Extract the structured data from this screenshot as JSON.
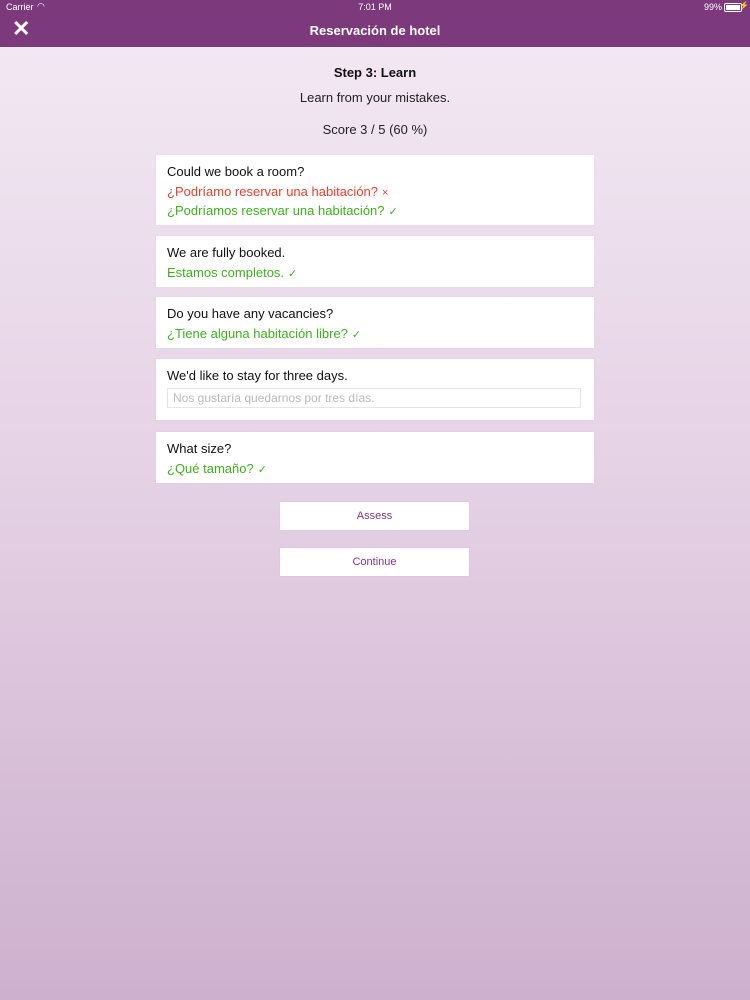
{
  "status_bar": {
    "carrier": "Carrier",
    "time": "7:01 PM",
    "battery": "99%"
  },
  "nav": {
    "title": "Reservación de hotel",
    "close_icon": "close-icon"
  },
  "step": {
    "title": "Step 3: Learn",
    "subtitle": "Learn from your mistakes.",
    "score": "Score 3 / 5 (60 %)"
  },
  "exercises": [
    {
      "question": "Could we book a room?",
      "wrong_answer": "¿Podríamo reservar una habitación?",
      "correct_answer": "¿Podríamos reservar una habitación?"
    },
    {
      "question": "We are fully booked.",
      "correct_answer": "Estamos completos."
    },
    {
      "question": "Do you have any vacancies?",
      "correct_answer": "¿Tiene alguna habitación libre?"
    },
    {
      "question": "We'd like to stay for three days.",
      "input_value": "",
      "input_placeholder": "Nos gustaría quedarnos por tres días."
    },
    {
      "question": "What size?",
      "correct_answer": "¿Qué tamaño?"
    }
  ],
  "marks": {
    "wrong": "×",
    "right": "✓"
  },
  "buttons": {
    "assess": "Assess",
    "continue": "Continue"
  },
  "colors": {
    "nav_bg": "#7c3a7c",
    "wrong": "#e0412e",
    "right": "#3fae1f",
    "button_text": "#7c3a7c"
  }
}
